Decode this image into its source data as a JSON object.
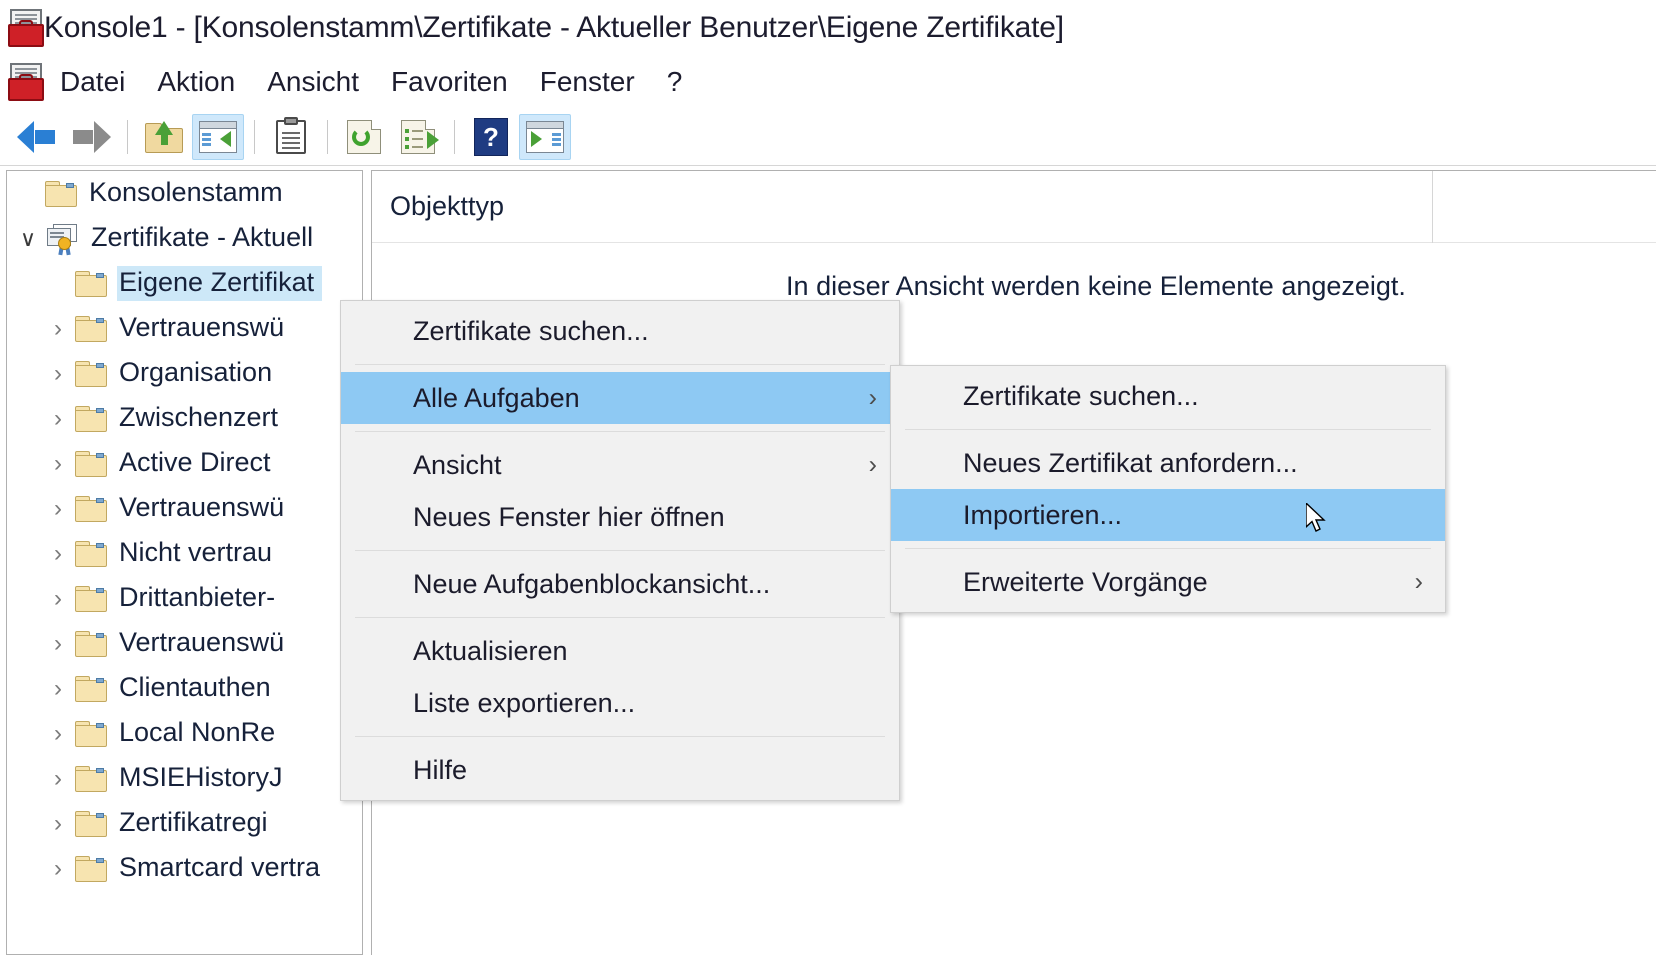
{
  "window": {
    "title": "Konsole1 - [Konsolenstamm\\Zertifikate - Aktueller Benutzer\\Eigene Zertifikate]",
    "app_icon": "mmc-console-icon"
  },
  "menubar": {
    "items": [
      {
        "label": "Datei",
        "name": "menu-datei"
      },
      {
        "label": "Aktion",
        "name": "menu-aktion"
      },
      {
        "label": "Ansicht",
        "name": "menu-ansicht"
      },
      {
        "label": "Favoriten",
        "name": "menu-favoriten"
      },
      {
        "label": "Fenster",
        "name": "menu-fenster"
      },
      {
        "label": "?",
        "name": "menu-help"
      }
    ]
  },
  "toolbar": {
    "buttons": [
      {
        "name": "back-arrow-icon",
        "active": false
      },
      {
        "name": "forward-arrow-icon",
        "active": false
      },
      {
        "name": "up-one-level-icon",
        "active": false
      },
      {
        "name": "show-hide-console-tree-icon",
        "active": true
      },
      {
        "name": "properties-clipboard-icon",
        "active": false
      },
      {
        "name": "refresh-icon",
        "active": false
      },
      {
        "name": "export-list-icon",
        "active": false
      },
      {
        "name": "help-icon",
        "active": false
      },
      {
        "name": "show-hide-action-pane-icon",
        "active": true
      }
    ]
  },
  "tree": {
    "items": [
      {
        "label": "Konsolenstamm",
        "icon": "folder-icon",
        "indent": 0,
        "chevron": "none",
        "selected": false
      },
      {
        "label": "Zertifikate - Aktuell",
        "icon": "certificate-icon",
        "indent": 0,
        "chevron": "expanded",
        "selected": false
      },
      {
        "label": "Eigene Zertifikat",
        "icon": "folder-icon",
        "indent": 1,
        "chevron": "none",
        "selected": true
      },
      {
        "label": "Vertrauenswü",
        "icon": "folder-icon",
        "indent": 1,
        "chevron": "collapsed",
        "selected": false
      },
      {
        "label": "Organisation",
        "icon": "folder-icon",
        "indent": 1,
        "chevron": "collapsed",
        "selected": false
      },
      {
        "label": "Zwischenzert",
        "icon": "folder-icon",
        "indent": 1,
        "chevron": "collapsed",
        "selected": false
      },
      {
        "label": "Active Direct",
        "icon": "folder-icon",
        "indent": 1,
        "chevron": "collapsed",
        "selected": false
      },
      {
        "label": "Vertrauenswü",
        "icon": "folder-icon",
        "indent": 1,
        "chevron": "collapsed",
        "selected": false
      },
      {
        "label": "Nicht vertrau",
        "icon": "folder-icon",
        "indent": 1,
        "chevron": "collapsed",
        "selected": false
      },
      {
        "label": "Drittanbieter-",
        "icon": "folder-icon",
        "indent": 1,
        "chevron": "collapsed",
        "selected": false
      },
      {
        "label": "Vertrauenswü",
        "icon": "folder-icon",
        "indent": 1,
        "chevron": "collapsed",
        "selected": false
      },
      {
        "label": "Clientauthen",
        "icon": "folder-icon",
        "indent": 1,
        "chevron": "collapsed",
        "selected": false
      },
      {
        "label": "Local NonRe",
        "icon": "folder-icon",
        "indent": 1,
        "chevron": "collapsed",
        "selected": false
      },
      {
        "label": "MSIEHistoryJ",
        "icon": "folder-icon",
        "indent": 1,
        "chevron": "collapsed",
        "selected": false
      },
      {
        "label": "Zertifikatregi",
        "icon": "folder-icon",
        "indent": 1,
        "chevron": "collapsed",
        "selected": false
      },
      {
        "label": "Smartcard vertra",
        "icon": "folder-icon",
        "indent": 1,
        "chevron": "collapsed",
        "selected": false
      }
    ]
  },
  "list_pane": {
    "column_header": "Objekttyp",
    "empty_message": "In dieser Ansicht werden keine Elemente angezeigt."
  },
  "context_menu": {
    "items": [
      {
        "label": "Zertifikate suchen...",
        "name": "ctx-zertifikate-suchen",
        "submenu": false,
        "selected": false,
        "sep_after": true
      },
      {
        "label": "Alle Aufgaben",
        "name": "ctx-alle-aufgaben",
        "submenu": true,
        "selected": true,
        "sep_after": true
      },
      {
        "label": "Ansicht",
        "name": "ctx-ansicht",
        "submenu": true,
        "selected": false,
        "sep_after": false
      },
      {
        "label": "Neues Fenster hier öffnen",
        "name": "ctx-neues-fenster",
        "submenu": false,
        "selected": false,
        "sep_after": true
      },
      {
        "label": "Neue Aufgabenblockansicht...",
        "name": "ctx-neue-aufgabenblock",
        "submenu": false,
        "selected": false,
        "sep_after": true
      },
      {
        "label": "Aktualisieren",
        "name": "ctx-aktualisieren",
        "submenu": false,
        "selected": false,
        "sep_after": false
      },
      {
        "label": "Liste exportieren...",
        "name": "ctx-liste-exportieren",
        "submenu": false,
        "selected": false,
        "sep_after": true
      },
      {
        "label": "Hilfe",
        "name": "ctx-hilfe",
        "submenu": false,
        "selected": false,
        "sep_after": false
      }
    ]
  },
  "submenu": {
    "items": [
      {
        "label": "Zertifikate suchen...",
        "name": "sub-zertifikate-suchen",
        "submenu": false,
        "selected": false,
        "sep_after": true
      },
      {
        "label": "Neues Zertifikat anfordern...",
        "name": "sub-neues-zertifikat",
        "submenu": false,
        "selected": false,
        "sep_after": false
      },
      {
        "label": "Importieren...",
        "name": "sub-importieren",
        "submenu": false,
        "selected": true,
        "sep_after": true
      },
      {
        "label": "Erweiterte Vorgänge",
        "name": "sub-erweiterte-vorgaenge",
        "submenu": true,
        "selected": false,
        "sep_after": false
      }
    ]
  },
  "icons": {
    "submenu_arrow": "›",
    "chevron_collapsed": "›",
    "chevron_expanded": "∨"
  },
  "colors": {
    "menu_highlight": "#8ec9f3",
    "tree_selection": "#cde8f8",
    "toolbar_active": "#cfe8fb",
    "text": "#1b1b2b",
    "menu_background": "#f1f1f1"
  }
}
